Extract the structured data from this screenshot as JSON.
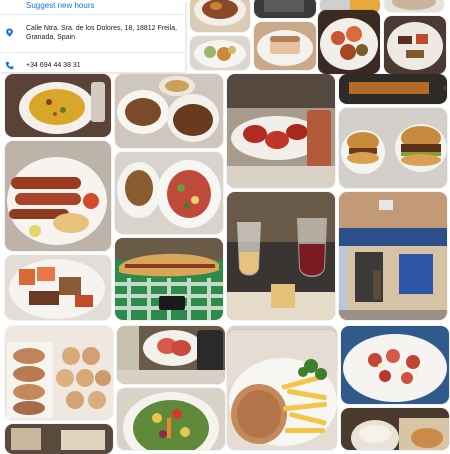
{
  "place": {
    "suggest_link": "Suggest new hours",
    "address": "Calle Ntra. Sra. de los Dolores, 18, 18812 Freila, Granada, Spain",
    "phone": "+34 694 44 38 31",
    "icons": {
      "location": "location-pin-icon",
      "phone": "phone-icon"
    }
  },
  "gallery": {
    "next_arrow": "‹",
    "photos": [
      "food-photo",
      "food-photo",
      "food-photo",
      "food-photo",
      "food-photo",
      "food-photo",
      "paella-photo",
      "tapas-plates-photo",
      "ham-tomato-photo",
      "burger-photo",
      "sausage-plate-photo",
      "salad-photo",
      "wine-glass-photo",
      "bar-storefront-photo",
      "baguette-photo",
      "drinks-bread-photo",
      "bread-rolls-photo",
      "ham-tomato-plate-photo",
      "drink-glass-photo",
      "fries-dish-photo",
      "salad-dish-photo"
    ]
  },
  "colors": {
    "link": "#1a73e8",
    "icon": "#1a73e8"
  }
}
